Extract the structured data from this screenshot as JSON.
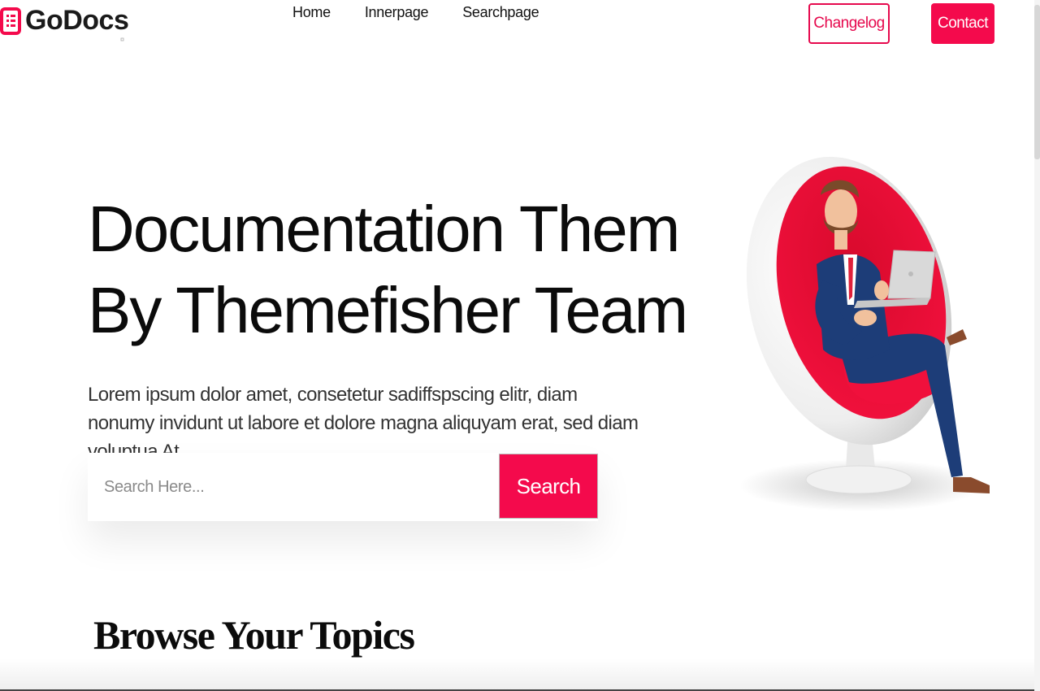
{
  "brand": {
    "name": "GoDocs",
    "accent_color": "#f40a4c",
    "logo_icon": "document-icon"
  },
  "nav": {
    "links": [
      {
        "label": "Home"
      },
      {
        "label": "Innerpage"
      },
      {
        "label": "Searchpage"
      }
    ]
  },
  "header_buttons": {
    "changelog_label": "Changelog",
    "contact_label": "Contact"
  },
  "hero": {
    "title_line1": "Documentation Them",
    "title_line2": "By Themefisher Team",
    "description": "Lorem ipsum dolor amet, consetetur sadiffspscing elitr, diam nonumy invidunt ut labore et dolore magna aliquyam erat, sed diam voluptua At.",
    "illustration": "man-in-egg-chair-with-laptop"
  },
  "search": {
    "placeholder": "Search Here...",
    "button_label": "Search"
  },
  "browse": {
    "title": "Browse Your Topics"
  }
}
